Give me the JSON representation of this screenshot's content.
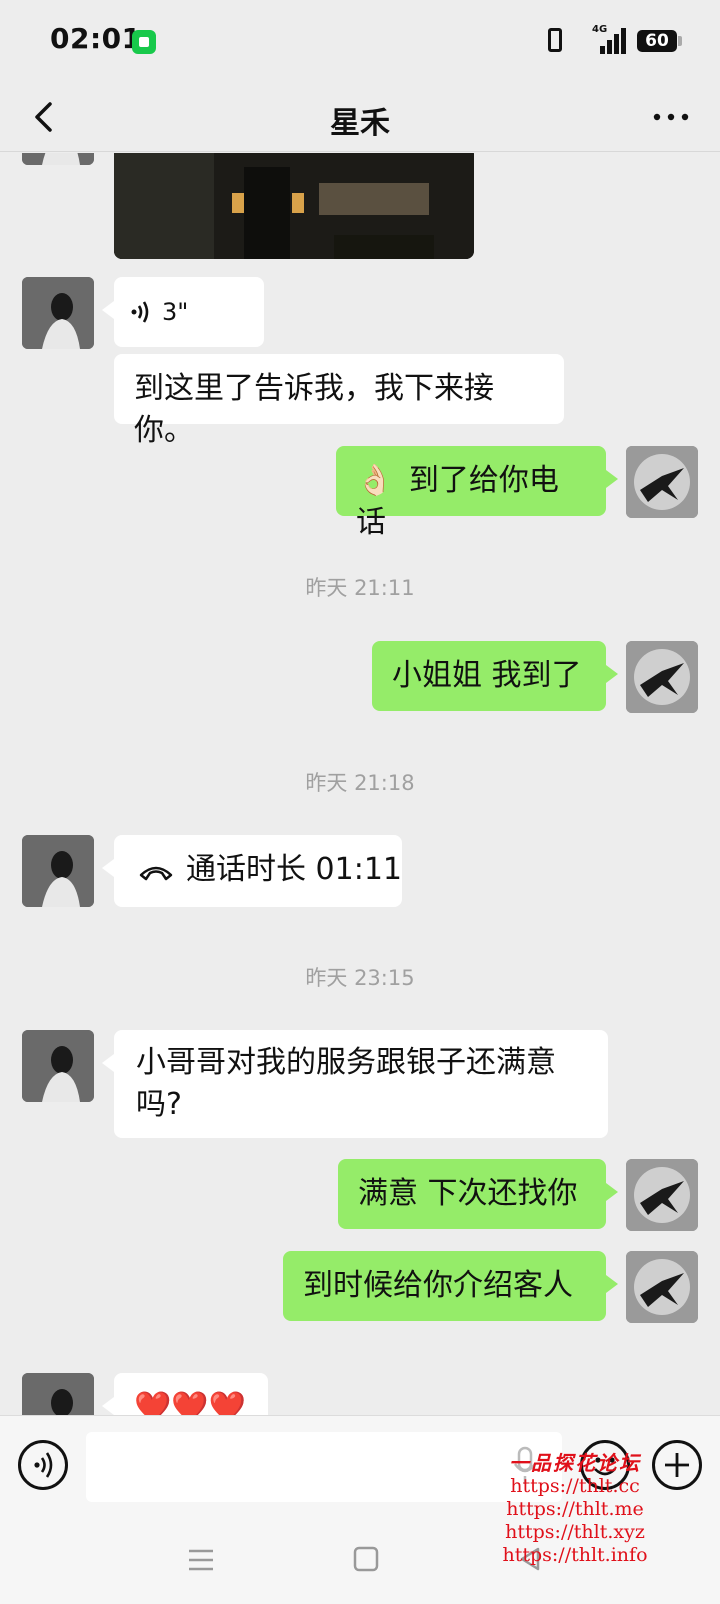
{
  "status_bar": {
    "time": "02:01",
    "network": "4G",
    "battery": "60"
  },
  "header": {
    "title": "星禾"
  },
  "messages": {
    "voice": {
      "duration": "3\""
    },
    "m_left_1": "到这里了告诉我，我下来接你。",
    "m_right_1_emoji": "👌🏻",
    "m_right_1": "到了给你电话",
    "ts_1": "昨天 21:11",
    "m_right_2": "小姐姐 我到了",
    "ts_2": "昨天 21:18",
    "call": "通话时长 01:11",
    "ts_3": "昨天 23:15",
    "m_left_2": "小哥哥对我的服务跟银子还满意吗?",
    "m_right_3": "满意 下次还找你",
    "m_right_4": "到时候给你介绍客人",
    "m_left_3": "❤️❤️❤️"
  },
  "input": {
    "value": ""
  },
  "watermark": {
    "title": "一品探花论坛",
    "urls": [
      "https://thlt.cc",
      "https://thlt.me",
      "https://thlt.xyz",
      "https://thlt.info"
    ]
  },
  "colors": {
    "sent_bubble": "#95ec69",
    "received_bubble": "#ffffff",
    "background": "#ededed",
    "watermark": "#e0101a"
  }
}
